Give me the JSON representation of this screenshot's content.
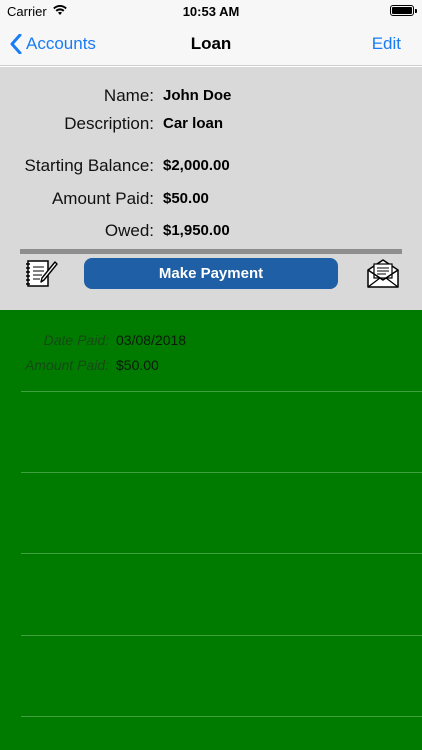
{
  "status_bar": {
    "carrier": "Carrier",
    "time": "10:53 AM",
    "icons": [
      "wifi-icon",
      "battery-icon"
    ]
  },
  "nav": {
    "back_label": "Accounts",
    "title": "Loan",
    "edit_label": "Edit"
  },
  "details": {
    "name_label": "Name:",
    "name_value": "John Doe",
    "description_label": "Description:",
    "description_value": "Car loan",
    "starting_balance_label": "Starting Balance:",
    "starting_balance_value": "$2,000.00",
    "amount_paid_label": "Amount Paid:",
    "amount_paid_value": "$50.00",
    "owed_label": "Owed:",
    "owed_value": "$1,950.00"
  },
  "actions": {
    "notes_icon": "notepad-pencil-icon",
    "make_payment_label": "Make Payment",
    "mail_icon": "open-envelope-icon"
  },
  "payments": [
    {
      "date_label": "Date Paid:",
      "date_value": "03/08/2018",
      "amount_label": "Amount Paid:",
      "amount_value": "$50.00"
    }
  ],
  "colors": {
    "accent": "#1a7cf4",
    "button": "#1e5fa5",
    "panel": "#d9d9d9",
    "list_background": "#007b00"
  }
}
